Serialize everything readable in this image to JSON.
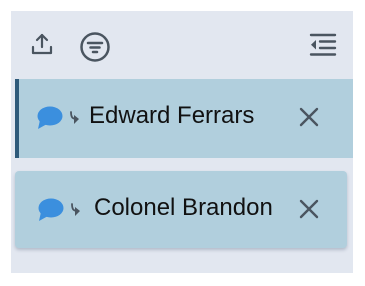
{
  "toolbar": {
    "icons": [
      "upload-icon",
      "filter-icon",
      "collapse-panel-icon"
    ]
  },
  "participants": [
    {
      "name": "Edward Ferrars",
      "active": true
    },
    {
      "name": "Colonel Brandon",
      "active": false
    }
  ],
  "colors": {
    "panel_background": "#e2e7f0",
    "item_background": "#b1cfdd",
    "active_indicator": "#2e5a7a",
    "chat_icon": "#3b8fde",
    "icon_gray": "#4a5560"
  }
}
